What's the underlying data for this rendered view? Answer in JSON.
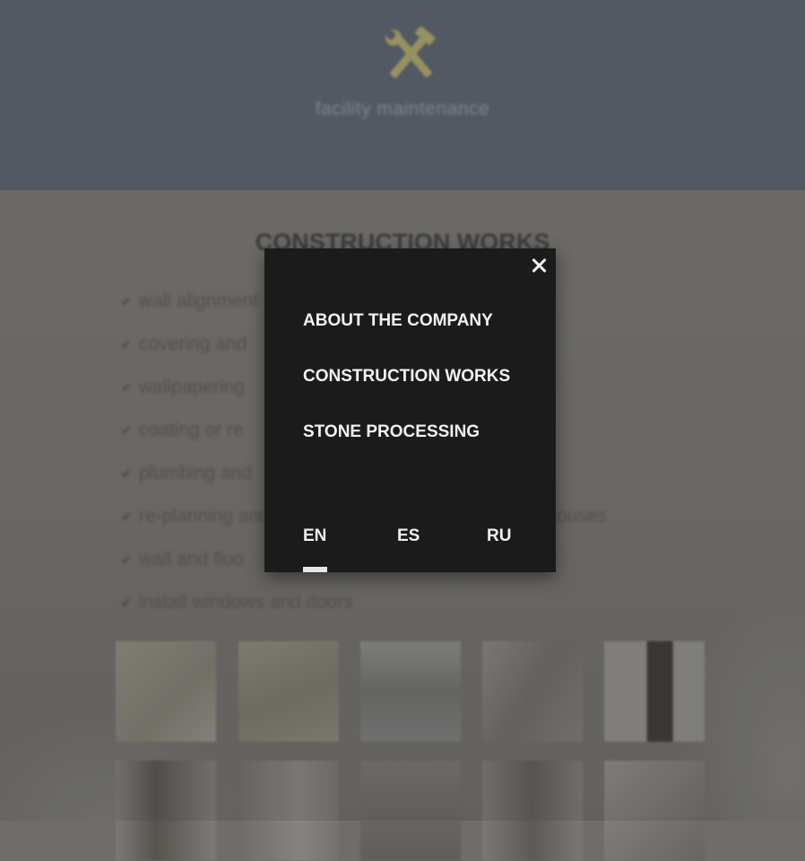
{
  "header": {
    "tagline": "facility maintenance",
    "logo_icon": "crossed-hammer-wrench-icon",
    "logo_color": "#b5ab68",
    "background": "#58606a"
  },
  "section": {
    "title": "CONSTRUCTION WORKS",
    "services": [
      "wall alignment",
      "covering and",
      "wallpapering",
      "coating or re",
      "plumbing and",
      "re-planning and improvement of apartments and houses",
      "wall and floo",
      "install windows and doors"
    ]
  },
  "gallery": {
    "rows": 2,
    "thumbs_per_row": 5
  },
  "modal": {
    "close_icon": "close-icon",
    "menu": [
      "ABOUT THE COMPANY",
      "CONSTRUCTION WORKS",
      "STONE PROCESSING"
    ],
    "languages": [
      "EN",
      "ES",
      "RU"
    ],
    "active_language": "EN",
    "background": "#1b1b1b"
  }
}
